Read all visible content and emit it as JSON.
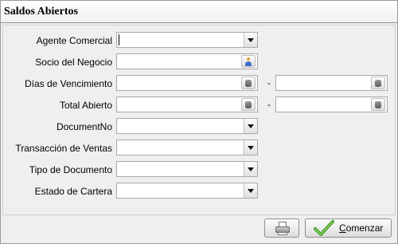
{
  "window": {
    "title": "Saldos Abiertos"
  },
  "form": {
    "agente_label": "Agente Comercial",
    "agente_value": "",
    "socio_label": "Socio del Negocio",
    "socio_value": "",
    "dias_label": "Días de Vencimiento",
    "dias_from": "",
    "dias_to": "",
    "total_label": "Total Abierto",
    "total_from": "",
    "total_to": "",
    "range_separator": "-",
    "documentno_label": "DocumentNo",
    "documentno_value": "",
    "transaccion_label": "Transacción de Ventas",
    "transaccion_value": "",
    "tipo_label": "Tipo de Documento",
    "tipo_value": "",
    "estado_label": "Estado de Cartera",
    "estado_value": ""
  },
  "footer": {
    "comenzar_first": "C",
    "comenzar_rest": "omenzar"
  },
  "colors": {
    "check_green": "#3f9a1e",
    "accent_blue": "#3d6ec9"
  },
  "icons": {
    "combo": "chevron-down-icon",
    "calculator": "calculator-icon",
    "partner": "business-partner-icon",
    "print": "printer-icon",
    "ok": "check-icon"
  }
}
